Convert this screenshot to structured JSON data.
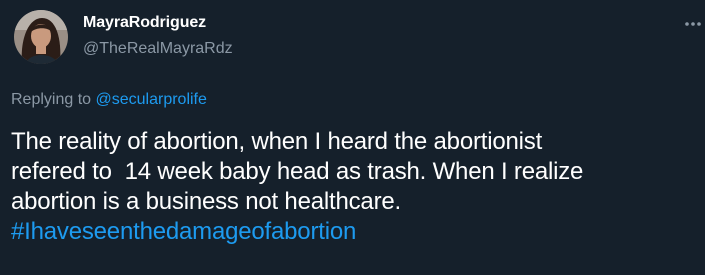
{
  "author": {
    "display_name": "MayraRodriguez",
    "handle": "@TheRealMayraRdz",
    "avatar_icon": "profile-photo"
  },
  "more_icon": "ellipsis-icon",
  "reply": {
    "prefix": "Replying to ",
    "mention": "@secularprolife"
  },
  "tweet": {
    "text": "The reality of abortion, when I heard the abortionist\nrefered to  14 week baby head as trash. When I realize\nabortion is a business not healthcare.\n",
    "hashtag": "#Ihaveseenthedamageofabortion"
  },
  "colors": {
    "background": "#15202b",
    "primary_text": "#ffffff",
    "secondary_text": "#8b98a5",
    "link": "#1d9bf0"
  }
}
